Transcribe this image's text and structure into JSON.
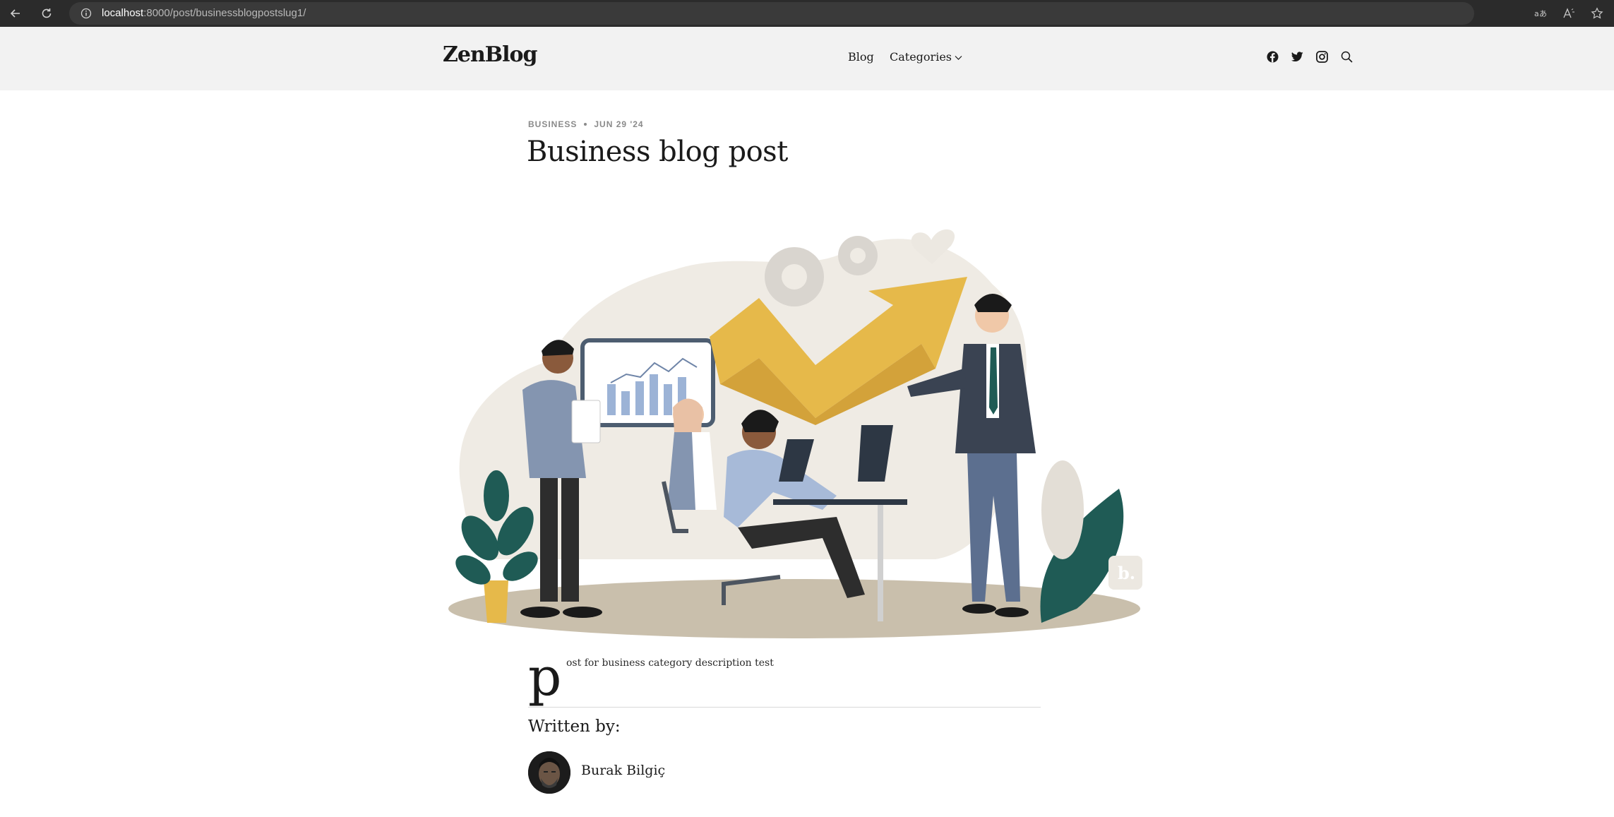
{
  "browser": {
    "url_host": "localhost",
    "url_rest": ":8000/post/businessblogpostslug1/",
    "read_aloud_label": "Aˆ"
  },
  "header": {
    "logo": "ZenBlog",
    "nav": {
      "blog": "Blog",
      "categories": "Categories"
    }
  },
  "post": {
    "category": "BUSINESS",
    "date": "JUN 29 '24",
    "title": "Business blog post",
    "drop_cap": "p",
    "body": "ost for business category description test",
    "written_by": "Written by:",
    "author": "Burak Bilgiç"
  },
  "illustration": {
    "watermark": "b."
  },
  "colors": {
    "header_bg": "#f2f2f2",
    "browser_bg": "#2b2b2b",
    "accent_yellow": "#e6b94a",
    "accent_teal": "#1f5b55",
    "text": "#1a1a1a"
  }
}
